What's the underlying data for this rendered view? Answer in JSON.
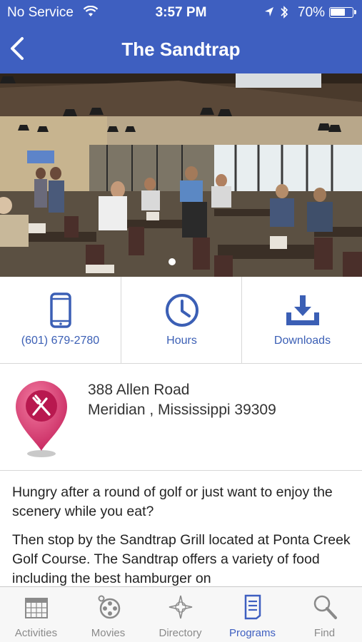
{
  "colors": {
    "brand": "#3e5fc0",
    "accent_text": "#3b5fb5",
    "pin": "#e4427a",
    "tab_inactive": "#8a8a8a"
  },
  "status_bar": {
    "carrier": "No Service",
    "time": "3:57 PM",
    "battery": "70%",
    "battery_level": 0.7,
    "icons": [
      "wifi-icon",
      "location-icon",
      "bluetooth-icon",
      "battery-icon"
    ]
  },
  "nav": {
    "title": "The Sandtrap",
    "back_icon": "chevron-left-icon"
  },
  "hero": {
    "page_count": 1,
    "current_page": 1
  },
  "actions": [
    {
      "label": "(601) 679-2780",
      "icon": "phone-icon"
    },
    {
      "label": "Hours",
      "icon": "clock-icon"
    },
    {
      "label": "Downloads",
      "icon": "download-icon"
    }
  ],
  "address": {
    "line1": "388 Allen Road",
    "line2": "Meridian , Mississippi 39309",
    "icon": "restaurant-pin-icon"
  },
  "description": {
    "p1": "Hungry after a round of golf or just want to enjoy the scenery while you eat?",
    "p2": "Then stop by the Sandtrap Grill located at Ponta Creek Golf Course. The Sandtrap offers a variety of food including the best hamburger on"
  },
  "tabs": [
    {
      "label": "Activities",
      "icon": "calendar-icon",
      "active": false
    },
    {
      "label": "Movies",
      "icon": "film-reel-icon",
      "active": false
    },
    {
      "label": "Directory",
      "icon": "compass-icon",
      "active": false
    },
    {
      "label": "Programs",
      "icon": "document-icon",
      "active": true
    },
    {
      "label": "Find",
      "icon": "search-icon",
      "active": false
    }
  ]
}
